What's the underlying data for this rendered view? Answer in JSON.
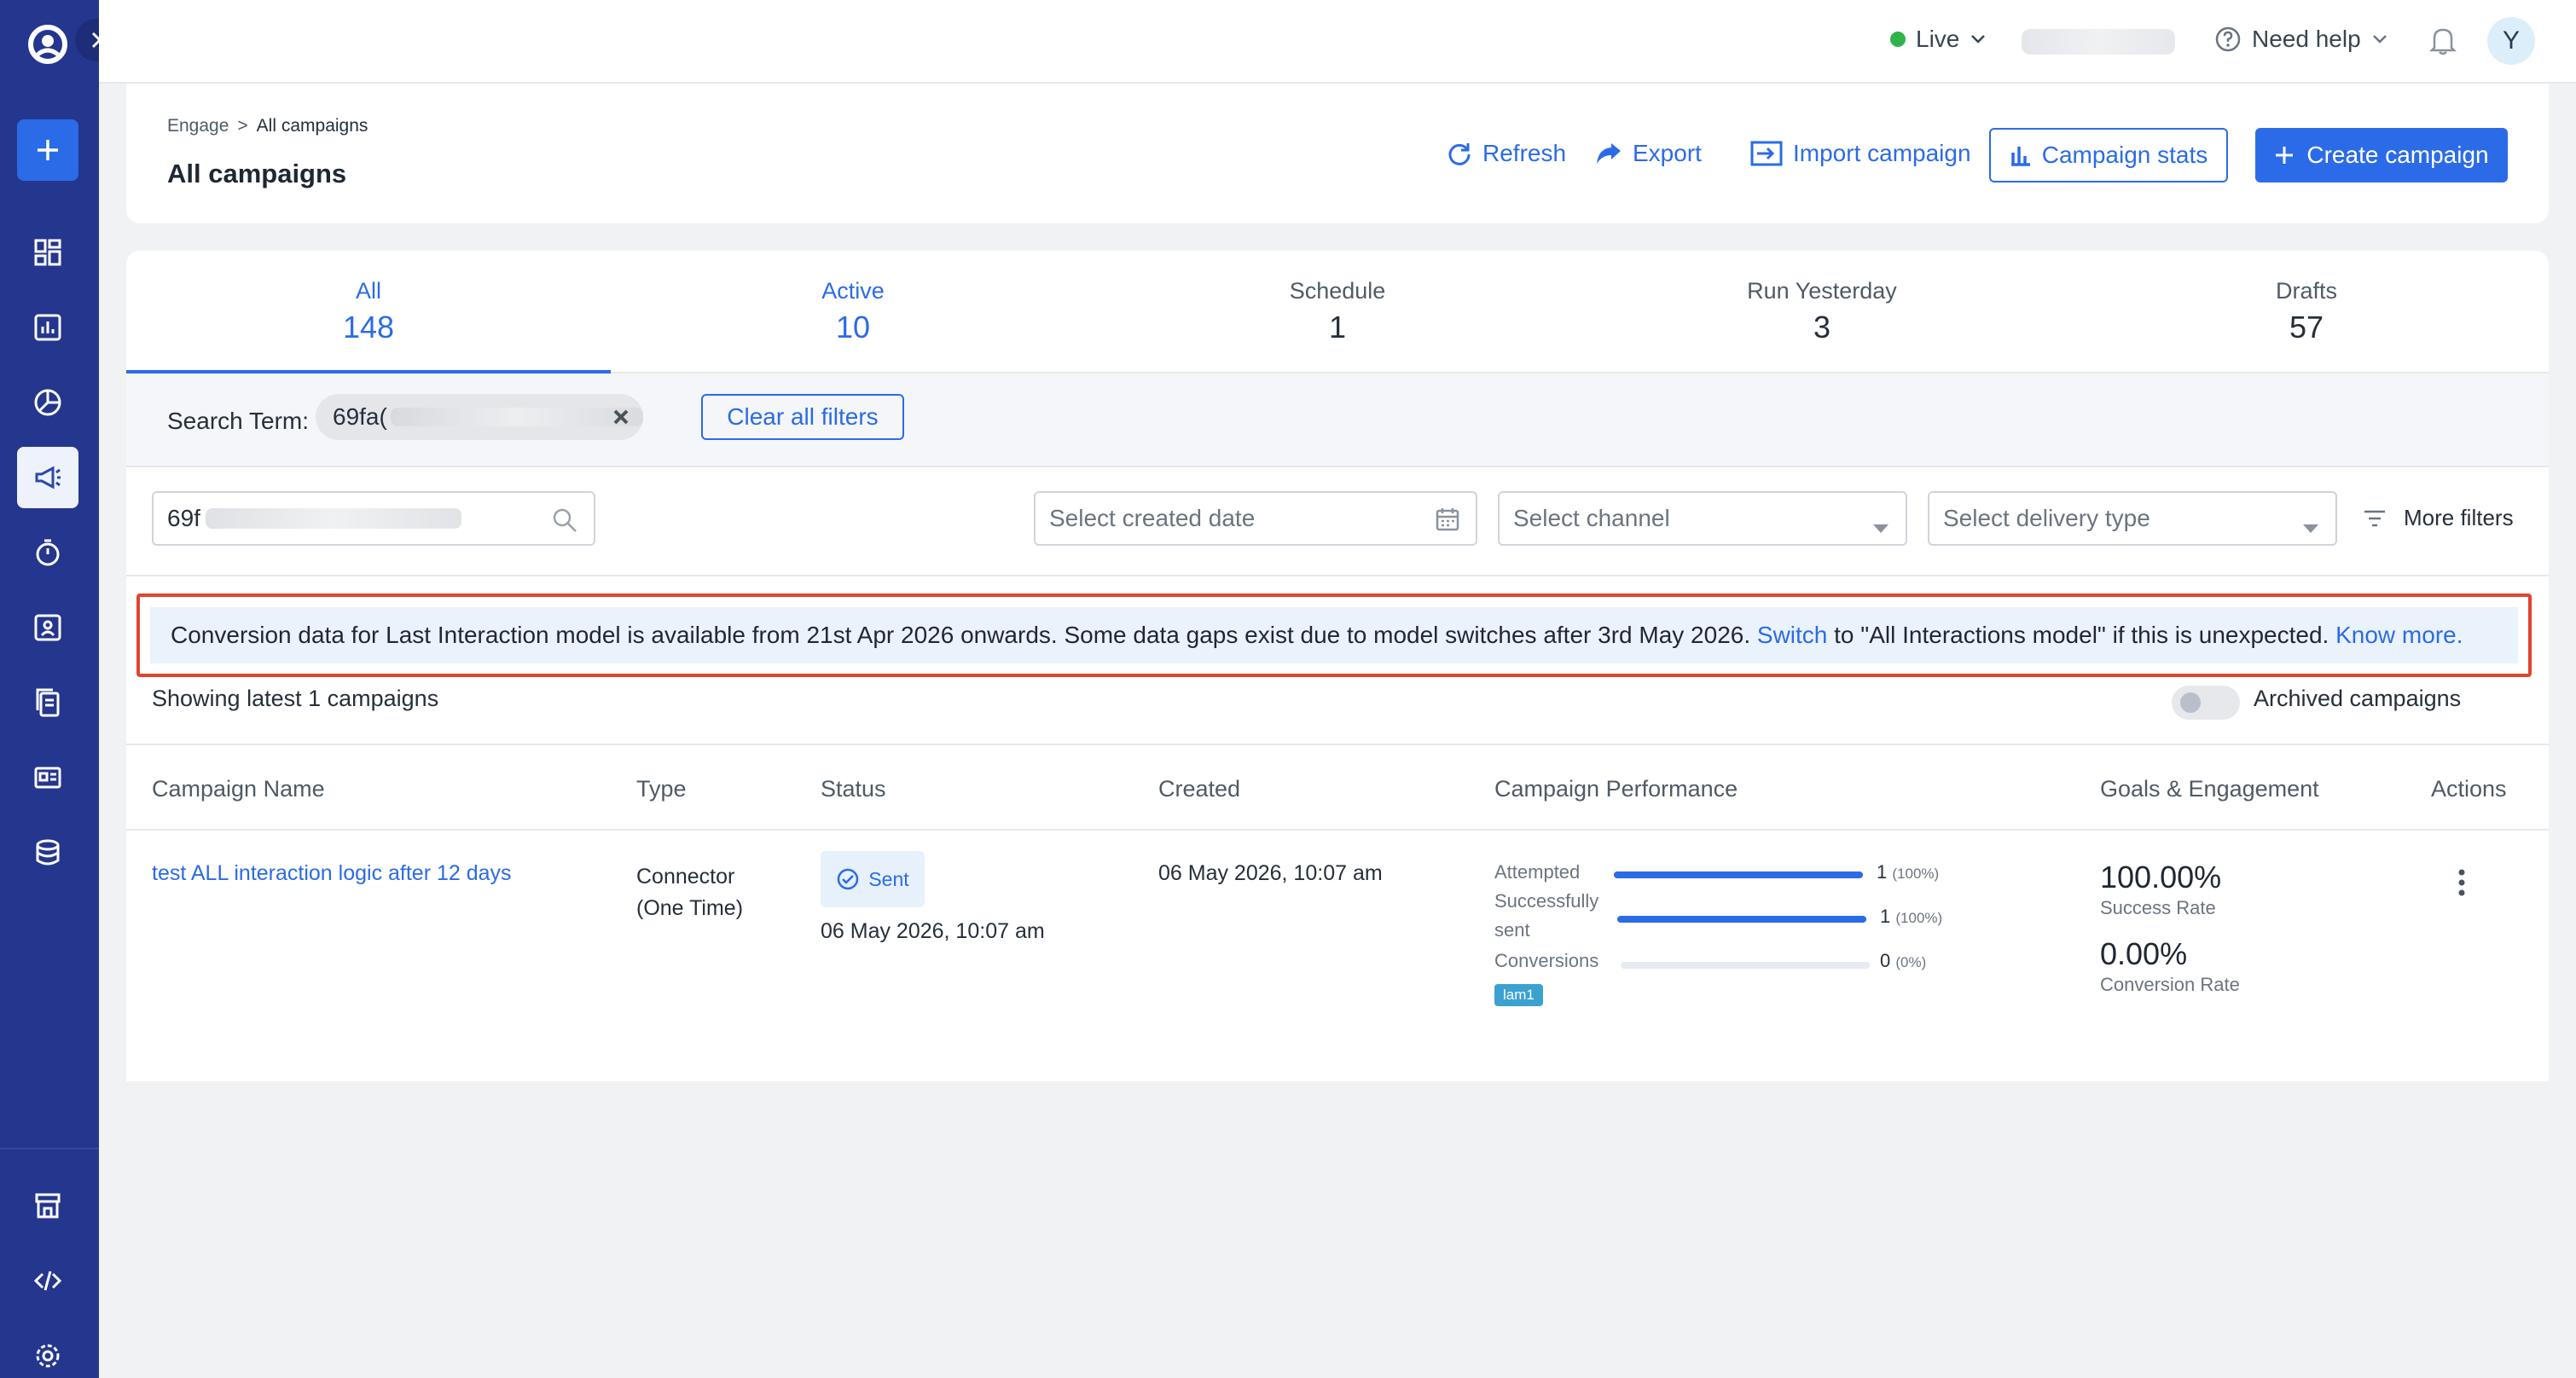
{
  "topbar": {
    "environment": "Live",
    "help": "Need help",
    "avatar_initial": "Y"
  },
  "header": {
    "breadcrumb": {
      "parent": "Engage",
      "separator": ">",
      "current": "All campaigns"
    },
    "title": "All campaigns",
    "actions": {
      "refresh": "Refresh",
      "export": "Export",
      "import": "Import campaign",
      "stats": "Campaign stats",
      "create": "Create campaign"
    }
  },
  "tabs": [
    {
      "label": "All",
      "count": "148"
    },
    {
      "label": "Active",
      "count": "10"
    },
    {
      "label": "Schedule",
      "count": "1"
    },
    {
      "label": "Run Yesterday",
      "count": "3"
    },
    {
      "label": "Drafts",
      "count": "57"
    }
  ],
  "filters": {
    "search_term_label": "Search Term:",
    "chip_prefix": "69fa(",
    "clear_all": "Clear all filters",
    "search_value": "69f",
    "created_date_placeholder": "Select created date",
    "channel_placeholder": "Select channel",
    "delivery_type_placeholder": "Select delivery type",
    "more_filters": "More filters"
  },
  "banner": {
    "text_before": "Conversion data for Last Interaction model is available from 21st Apr 2026 onwards. Some data gaps exist due to model switches after 3rd May 2026.",
    "switch_link": "Switch",
    "text_after": "to \"All Interactions model\" if this is unexpected.",
    "know_more": "Know more."
  },
  "list": {
    "showing": "Showing latest 1 campaigns",
    "archived_label": "Archived campaigns",
    "archived_on": false
  },
  "table": {
    "headers": {
      "name": "Campaign Name",
      "type": "Type",
      "status": "Status",
      "created": "Created",
      "performance": "Campaign Performance",
      "goals": "Goals & Engagement",
      "actions": "Actions"
    },
    "rows": [
      {
        "name": "test ALL interaction logic after 12 days",
        "type_line1": "Connector",
        "type_line2": "(One Time)",
        "status": "Sent",
        "status_date": "06 May 2026, 10:07 am",
        "created": "06 May 2026, 10:07 am",
        "performance": {
          "attempted": {
            "label": "Attempted",
            "value": "1",
            "pct": "(100%)",
            "fill": 1.0
          },
          "sent": {
            "label1": "Successfully",
            "label2": "sent",
            "value": "1",
            "pct": "(100%)",
            "fill": 1.0
          },
          "conversions": {
            "label": "Conversions",
            "value": "0",
            "pct": "(0%)",
            "fill": 0.0
          },
          "tag": "lam1"
        },
        "success_rate_value": "100.00%",
        "success_rate_label": "Success Rate",
        "conversion_rate_value": "0.00%",
        "conversion_rate_label": "Conversion Rate"
      }
    ]
  },
  "colors": {
    "sidebar": "#24368e",
    "accent": "#2b6be7",
    "live_dot": "#2fb34a",
    "banner_border": "#e0442e",
    "banner_bg": "#eaf2fc",
    "tag_bg": "#3ba2d0"
  },
  "icons": [
    "user-circle-logo-icon",
    "chevron-right-icon",
    "plus-icon",
    "dashboard-icon",
    "bar-chart-icon",
    "pie-chart-icon",
    "megaphone-icon",
    "stopwatch-icon",
    "user-card-icon",
    "documents-icon",
    "newsletter-icon",
    "database-icon",
    "store-icon",
    "code-icon",
    "gear-icon",
    "chevron-down-icon",
    "help-circle-icon",
    "bell-icon",
    "refresh-icon",
    "share-arrow-icon",
    "import-icon",
    "stats-icon",
    "close-icon",
    "search-icon",
    "calendar-icon",
    "filter-icon",
    "check-circle-icon",
    "kebab-icon"
  ]
}
